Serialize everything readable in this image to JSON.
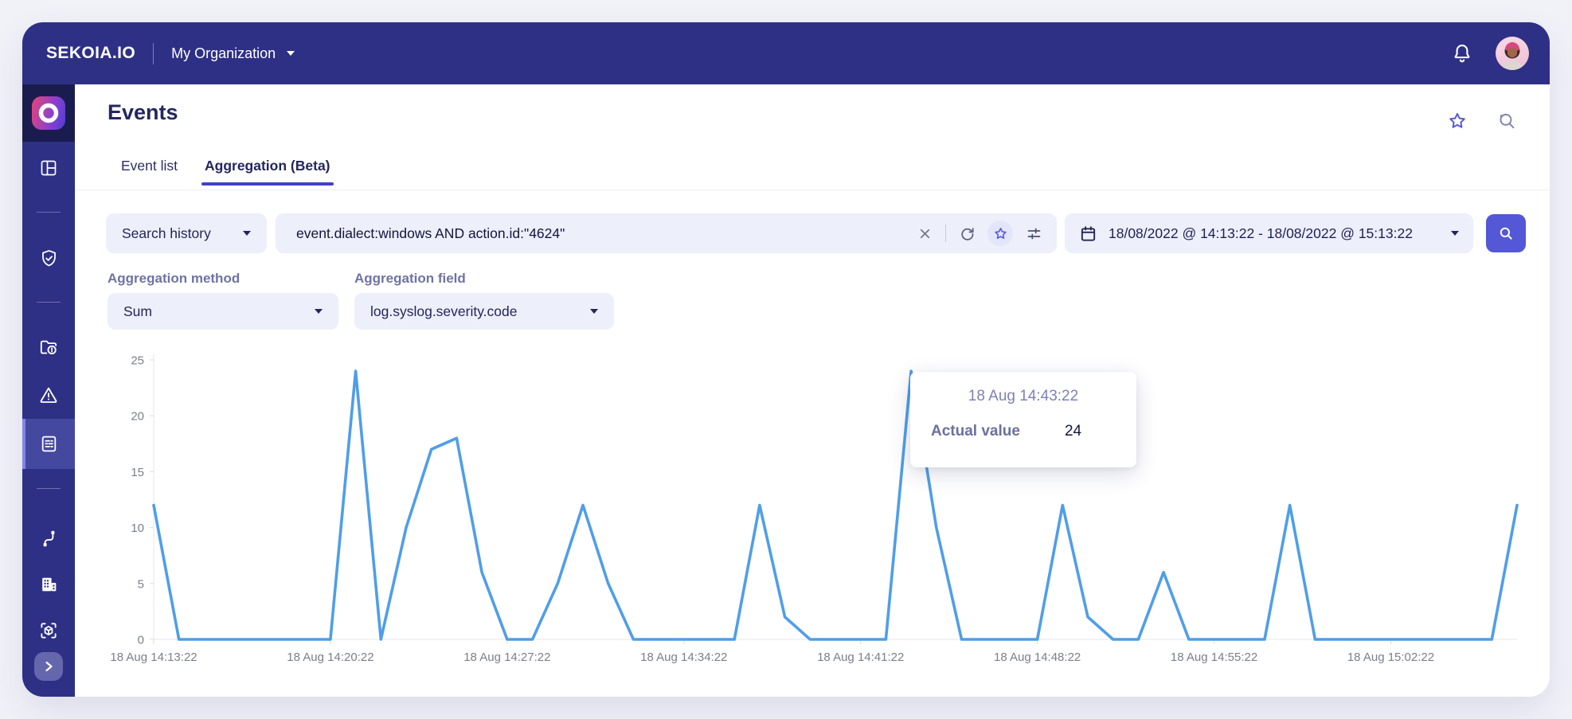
{
  "topbar": {
    "brand": "SEKOIA.IO",
    "org": "My Organization",
    "icons": [
      "bell-icon",
      "avatar"
    ]
  },
  "sidebar": {
    "icons": [
      "sekoia-logo",
      "dashboard-icon",
      "shield-check-icon",
      "folder-alert-icon",
      "warning-triangle-icon",
      "events-document-icon",
      "intake-cable-icon",
      "building-icon",
      "cube-scan-icon",
      "expand-chevron-icon"
    ],
    "active_item": "events-document-icon",
    "accent_color": "#8284ea"
  },
  "header": {
    "title": "Events",
    "tabs": [
      {
        "label": "Event list",
        "active": false
      },
      {
        "label": "Aggregation (Beta)",
        "active": true
      }
    ],
    "action_icons": [
      "star-icon",
      "search-history-icon"
    ]
  },
  "search": {
    "history_label": "Search history",
    "query": "event.dialect:windows AND action.id:\"4624\"",
    "field_icons": [
      "clear-x-icon",
      "refresh-icon",
      "star-icon",
      "filter-sliders-icon"
    ],
    "date_range": "18/08/2022 @ 14:13:22 - 18/08/2022 @ 15:13:22",
    "accent_color": "#5457d6"
  },
  "aggregation": {
    "method_label": "Aggregation method",
    "method_value": "Sum",
    "field_label": "Aggregation field",
    "field_value": "log.syslog.severity.code"
  },
  "tooltip": {
    "title": "18 Aug 14:43:22",
    "label": "Actual value",
    "value": "24"
  },
  "chart_data": {
    "type": "line",
    "title": "",
    "xlabel": "",
    "ylabel": "",
    "ylim": [
      0,
      25
    ],
    "y_ticks": [
      0,
      5,
      10,
      15,
      20,
      25
    ],
    "grid": false,
    "legend": false,
    "line_color": "#4f9ee8",
    "start_time": "18 Aug 14:13:22",
    "x_total_minutes": 54,
    "x_tick_minutes": [
      0,
      7,
      14,
      21,
      28,
      35,
      42,
      49
    ],
    "x_tick_labels": [
      "18 Aug 14:13:22",
      "18 Aug 14:20:22",
      "18 Aug 14:27:22",
      "18 Aug 14:34:22",
      "18 Aug 14:41:22",
      "18 Aug 14:48:22",
      "18 Aug 14:55:22",
      "18 Aug 15:02:22"
    ],
    "points_format": "[minutes_after_start_time, value]",
    "points": [
      [
        0,
        12
      ],
      [
        1,
        0
      ],
      [
        2,
        0
      ],
      [
        3,
        0
      ],
      [
        4,
        0
      ],
      [
        5,
        0
      ],
      [
        6,
        0
      ],
      [
        7,
        0
      ],
      [
        8,
        24
      ],
      [
        9,
        0
      ],
      [
        10,
        10
      ],
      [
        11,
        17
      ],
      [
        12,
        18
      ],
      [
        13,
        6
      ],
      [
        14,
        0
      ],
      [
        15,
        0
      ],
      [
        16,
        5
      ],
      [
        17,
        12
      ],
      [
        18,
        5
      ],
      [
        19,
        0
      ],
      [
        20,
        0
      ],
      [
        21,
        0
      ],
      [
        22,
        0
      ],
      [
        23,
        0
      ],
      [
        24,
        12
      ],
      [
        25,
        2
      ],
      [
        26,
        0
      ],
      [
        27,
        0
      ],
      [
        28,
        0
      ],
      [
        29,
        0
      ],
      [
        30,
        24
      ],
      [
        31,
        10
      ],
      [
        32,
        0
      ],
      [
        33,
        0
      ],
      [
        34,
        0
      ],
      [
        35,
        0
      ],
      [
        36,
        12
      ],
      [
        37,
        2
      ],
      [
        38,
        0
      ],
      [
        39,
        0
      ],
      [
        40,
        6
      ],
      [
        41,
        0
      ],
      [
        42,
        0
      ],
      [
        43,
        0
      ],
      [
        44,
        0
      ],
      [
        45,
        12
      ],
      [
        46,
        0
      ],
      [
        47,
        0
      ],
      [
        48,
        0
      ],
      [
        49,
        0
      ],
      [
        50,
        0
      ],
      [
        51,
        0
      ],
      [
        52,
        0
      ],
      [
        53,
        0
      ],
      [
        54,
        12
      ]
    ],
    "highlighted_point": {
      "time": "18 Aug 14:43:22",
      "value": 24
    }
  }
}
